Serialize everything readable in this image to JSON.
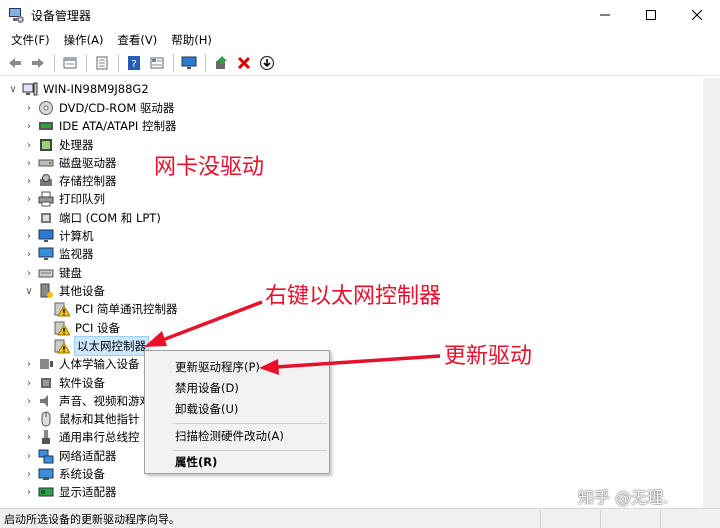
{
  "window": {
    "title": "设备管理器",
    "controls": [
      "minimize-icon",
      "maximize-icon",
      "close-icon"
    ]
  },
  "menu": {
    "items": [
      "文件(F)",
      "操作(A)",
      "查看(V)",
      "帮助(H)"
    ]
  },
  "toolbar": {
    "buttons": [
      "back-arrow-icon",
      "forward-arrow-icon",
      "properties-icon",
      "list-icon",
      "help-icon",
      "view-icon",
      "monitor-icon",
      "update-driver-icon",
      "uninstall-icon",
      "scan-icon"
    ]
  },
  "tree": {
    "root": "WIN-IN98M9J88G2",
    "categories": [
      {
        "label": "DVD/CD-ROM 驱动器",
        "icon": "dvd-icon"
      },
      {
        "label": "IDE ATA/ATAPI 控制器",
        "icon": "ide-controller-icon"
      },
      {
        "label": "处理器",
        "icon": "processor-icon"
      },
      {
        "label": "磁盘驱动器",
        "icon": "disk-drive-icon"
      },
      {
        "label": "存储控制器",
        "icon": "storage-controller-icon"
      },
      {
        "label": "打印队列",
        "icon": "printer-icon"
      },
      {
        "label": "端口 (COM 和 LPT)",
        "icon": "port-icon"
      },
      {
        "label": "计算机",
        "icon": "computer-icon"
      },
      {
        "label": "监视器",
        "icon": "monitor-icon"
      },
      {
        "label": "键盘",
        "icon": "keyboard-icon"
      },
      {
        "label": "其他设备",
        "icon": "other-devices-icon",
        "expanded": true
      }
    ],
    "other_devices": [
      {
        "label": "PCI 简单通讯控制器",
        "icon": "warning-device-icon"
      },
      {
        "label": "PCI 设备",
        "icon": "warning-device-icon"
      },
      {
        "label": "以太网控制器",
        "icon": "warning-device-icon",
        "selected": true
      }
    ],
    "categories_after": [
      {
        "label": "人体学输入设备",
        "icon": "hid-icon"
      },
      {
        "label": "软件设备",
        "icon": "software-device-icon"
      },
      {
        "label": "声音、视频和游戏",
        "icon": "sound-icon"
      },
      {
        "label": "鼠标和其他指针",
        "icon": "mouse-icon"
      },
      {
        "label": "通用串行总线控",
        "icon": "usb-icon"
      },
      {
        "label": "网络适配器",
        "icon": "network-adapter-icon"
      },
      {
        "label": "系统设备",
        "icon": "system-device-icon"
      },
      {
        "label": "显示适配器",
        "icon": "display-adapter-icon"
      }
    ]
  },
  "context_menu": {
    "items": [
      "更新驱动程序(P)",
      "禁用设备(D)",
      "卸载设备(U)",
      "扫描检测硬件改动(A)",
      "属性(R)"
    ]
  },
  "annotations": {
    "no_driver": "网卡没驱动",
    "right_click": "右键以太网控制器",
    "update_driver": "更新驱动",
    "color": "#e8102b"
  },
  "watermark": "知乎 @无理.",
  "status_bar": {
    "text": "启动所选设备的更新驱动程序向导。"
  }
}
